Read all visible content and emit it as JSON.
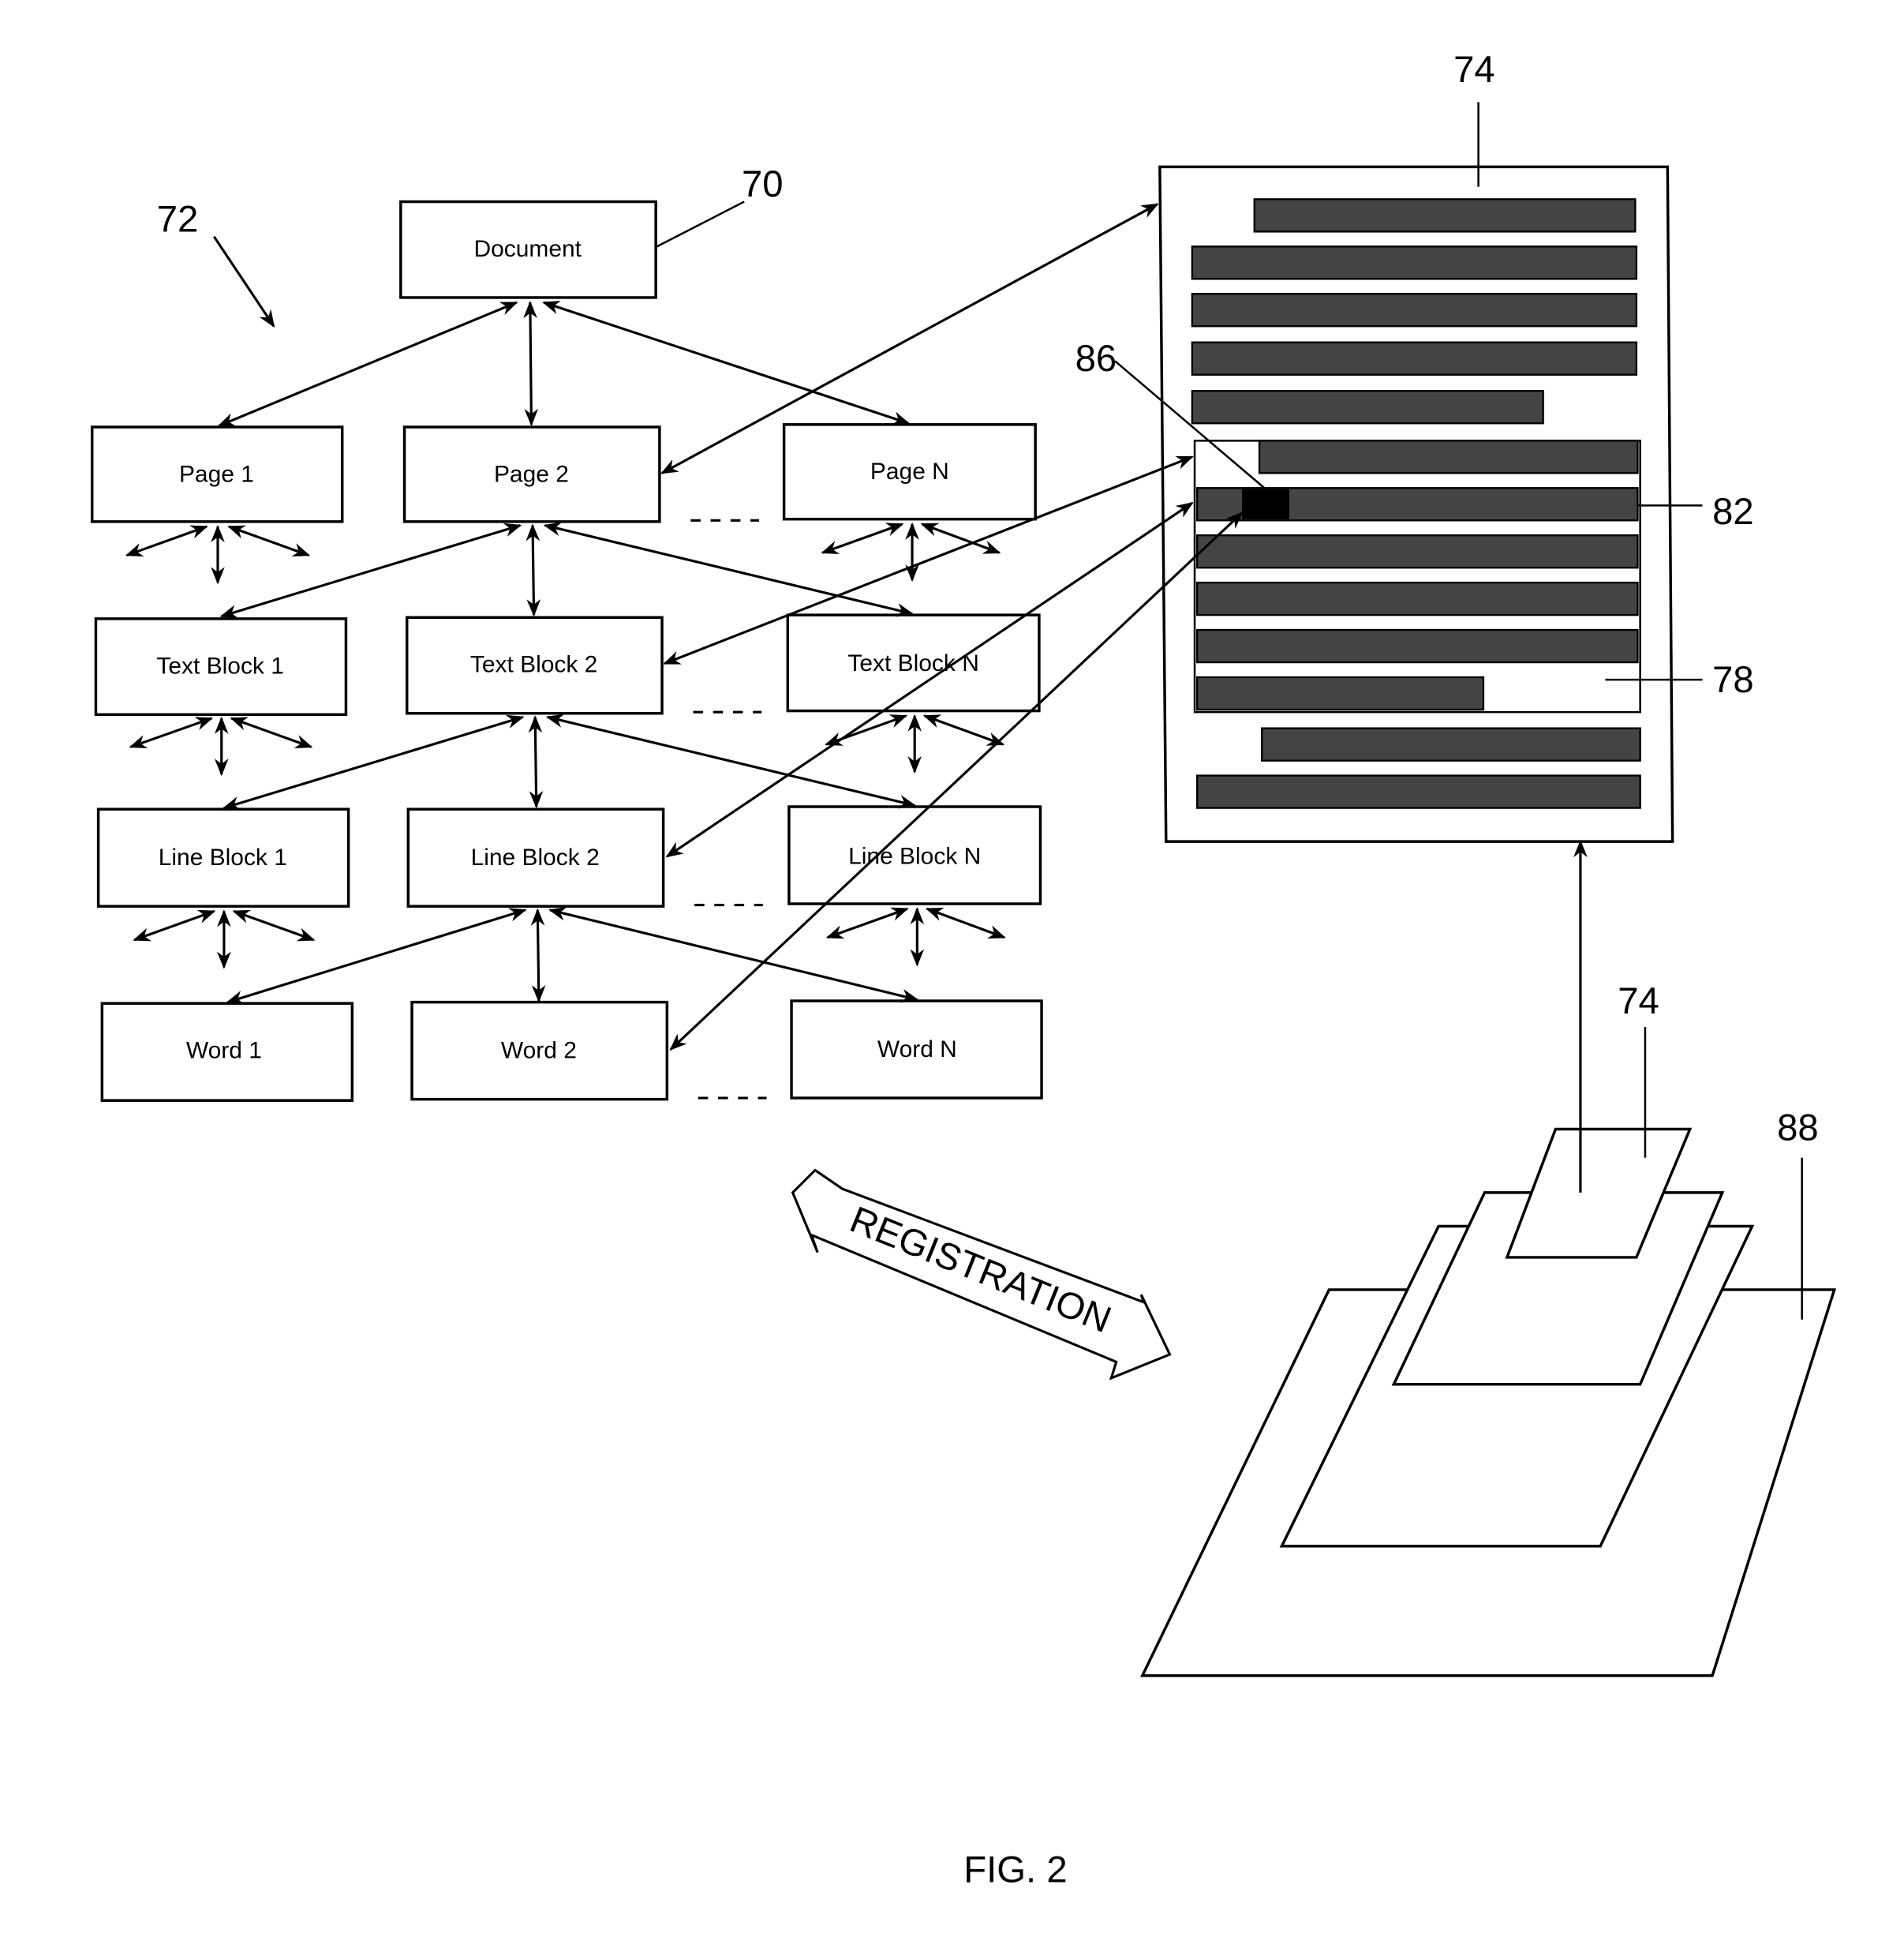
{
  "figure": {
    "caption": "FIG. 2",
    "tree": {
      "root": "Document",
      "rows": [
        [
          "Page 1",
          "Page 2",
          "Page N"
        ],
        [
          "Text Block 1",
          "Text Block 2",
          "Text Block N"
        ],
        [
          "Line Block 1",
          "Line Block 2",
          "Line Block N"
        ],
        [
          "Word 1",
          "Word 2",
          "Word N"
        ]
      ]
    },
    "reference_numerals": {
      "document": "70",
      "hierarchy": "72",
      "page_image": "74",
      "stack_top": "74",
      "word": "86",
      "line": "82",
      "text_block": "78",
      "stack": "88"
    },
    "registration_label": "REGISTRATION"
  }
}
